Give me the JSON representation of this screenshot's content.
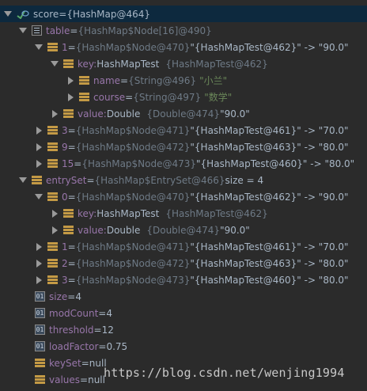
{
  "rows": [
    {
      "name": "score",
      "eq": " = ",
      "ref": "",
      "rest": "{HashMap@464}",
      "tail": ""
    },
    {
      "name": "table",
      "eq": " = ",
      "ref": "{HashMap$Node[16]@490}",
      "rest": "",
      "tail": ""
    },
    {
      "name": "1",
      "eq": " = ",
      "ref": "{HashMap$Node@470}",
      "rest": " \"{HashMapTest@462}\" -> \"90.0\"",
      "tail": ""
    },
    {
      "name": "key:",
      "eq": " ",
      "ref": "",
      "rest": "HashMapTest",
      "tail": "{HashMapTest@462}"
    },
    {
      "name": "name",
      "eq": " = ",
      "ref": "{String@496}",
      "rest": "",
      "tail": "\"小兰\""
    },
    {
      "name": "course",
      "eq": " = ",
      "ref": "{String@497}",
      "rest": "",
      "tail": "\"数学\""
    },
    {
      "name": "value:",
      "eq": " ",
      "ref": "",
      "rest": "Double",
      "tail": "{Double@474}"
    },
    {
      "name": "3",
      "eq": " = ",
      "ref": "{HashMap$Node@471}",
      "rest": " \"{HashMapTest@461}\" -> \"70.0\"",
      "tail": ""
    },
    {
      "name": "9",
      "eq": " = ",
      "ref": "{HashMap$Node@472}",
      "rest": " \"{HashMapTest@463}\" -> \"80.0\"",
      "tail": ""
    },
    {
      "name": "15",
      "eq": " = ",
      "ref": "{HashMap$Node@473}",
      "rest": " \"{HashMapTest@460}\" -> \"80.0\"",
      "tail": ""
    },
    {
      "name": "entrySet",
      "eq": " = ",
      "ref": "{HashMap$EntrySet@466}",
      "rest": "  size = 4",
      "tail": ""
    },
    {
      "name": "0",
      "eq": " = ",
      "ref": "{HashMap$Node@470}",
      "rest": " \"{HashMapTest@462}\" -> \"90.0\"",
      "tail": ""
    },
    {
      "name": "key:",
      "eq": " ",
      "ref": "",
      "rest": "HashMapTest",
      "tail": "{HashMapTest@462}"
    },
    {
      "name": "value:",
      "eq": " ",
      "ref": "",
      "rest": "Double",
      "tail": "{Double@474}"
    },
    {
      "name": "1",
      "eq": " = ",
      "ref": "{HashMap$Node@471}",
      "rest": " \"{HashMapTest@461}\" -> \"70.0\"",
      "tail": ""
    },
    {
      "name": "2",
      "eq": " = ",
      "ref": "{HashMap$Node@472}",
      "rest": " \"{HashMapTest@463}\" -> \"80.0\"",
      "tail": ""
    },
    {
      "name": "3",
      "eq": " = ",
      "ref": "{HashMap$Node@473}",
      "rest": " \"{HashMapTest@460}\" -> \"80.0\"",
      "tail": ""
    },
    {
      "name": "size",
      "eq": " = ",
      "ref": "",
      "rest": "4",
      "tail": ""
    },
    {
      "name": "modCount",
      "eq": " = ",
      "ref": "",
      "rest": "4",
      "tail": ""
    },
    {
      "name": "threshold",
      "eq": " = ",
      "ref": "",
      "rest": "12",
      "tail": ""
    },
    {
      "name": "loadFactor",
      "eq": " = ",
      "ref": "",
      "rest": "0.75",
      "tail": ""
    },
    {
      "name": "keySet",
      "eq": " = ",
      "ref": "",
      "rest": "null",
      "tail": ""
    },
    {
      "name": "values",
      "eq": " = ",
      "ref": "",
      "rest": "null",
      "tail": ""
    }
  ],
  "value_suffix_1": " \"90.0\"",
  "value_suffix_2": " \"90.0\"",
  "watermark": "https://blog.csdn.net/wenjing1994",
  "icons": {
    "watch": "watch-icon",
    "field": "field-icon",
    "array": "array-icon",
    "primitive": "primitive-icon"
  },
  "colors": {
    "background": "#2b2b2b",
    "selection": "#0d293e",
    "field_name": "#9876aa",
    "reference": "#6e7a86",
    "string": "#6a8759",
    "field_icon": "#c49a45"
  }
}
